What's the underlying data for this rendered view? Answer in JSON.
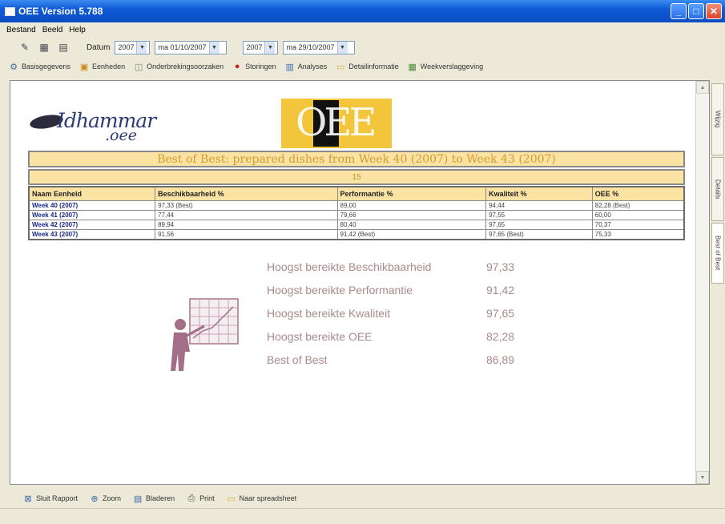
{
  "window": {
    "title": "OEE Version 5.788"
  },
  "menu": [
    "Bestand",
    "Beeld",
    "Help"
  ],
  "toolbar1": {
    "datum_label": "Datum",
    "combo1": {
      "year": "2007",
      "date": "ma 01/10/2007"
    },
    "combo2": {
      "year": "2007",
      "date": "ma 29/10/2007"
    }
  },
  "toolbar2": {
    "items": [
      {
        "icon": "settings-icon",
        "label": "Basisgegevens"
      },
      {
        "icon": "units-icon",
        "label": "Eenheden"
      },
      {
        "icon": "downtime-icon",
        "label": "Onderbrekingsoorzaken"
      },
      {
        "icon": "alert-icon",
        "label": "Storingen"
      },
      {
        "icon": "chart-icon",
        "label": "Analyses"
      },
      {
        "icon": "detail-icon",
        "label": "Detailinformatie"
      },
      {
        "icon": "report-icon",
        "label": "Weekverslaggeving"
      }
    ]
  },
  "sidetabs": [
    "Wijzig",
    "Details",
    "Best of Best"
  ],
  "report": {
    "logo": {
      "name": "Idhammar",
      "sub": ".oee"
    },
    "title": "Best of Best: prepared dishes from Week 40 (2007) to Week 43 (2007)",
    "subtitle": "15",
    "table": {
      "headers": [
        "Naam Eenheid",
        "Beschikbaarheid %",
        "Performantie %",
        "Kwaliteit %",
        "OEE %"
      ],
      "rows": [
        [
          "Week 40 (2007)",
          "97,33 (Best)",
          "89,00",
          "94,44",
          "82,28 (Best)"
        ],
        [
          "Week 41 (2007)",
          "77,44",
          "79,66",
          "97,55",
          "60,00"
        ],
        [
          "Week 42 (2007)",
          "89,94",
          "80,40",
          "97,65",
          "70,37"
        ],
        [
          "Week 43 (2007)",
          "91,56",
          "91,42 (Best)",
          "97,65 (Best)",
          "75,33"
        ]
      ]
    },
    "summary": [
      {
        "label": "Hoogst bereikte Beschikbaarheid",
        "value": "97,33"
      },
      {
        "label": "Hoogst bereikte Performantie",
        "value": "91,42"
      },
      {
        "label": "Hoogst bereikte Kwaliteit",
        "value": "97,65"
      },
      {
        "label": "Hoogst bereikte OEE",
        "value": "82,28"
      },
      {
        "label": "Best of Best",
        "value": "86,89"
      }
    ]
  },
  "bottombar": [
    {
      "icon": "close-report-icon",
      "label": "Sluit Rapport"
    },
    {
      "icon": "zoom-icon",
      "label": "Zoom"
    },
    {
      "icon": "browse-icon",
      "label": "Bladeren"
    },
    {
      "icon": "print-icon",
      "label": "Print"
    },
    {
      "icon": "export-icon",
      "label": "Naar spreadsheet"
    }
  ]
}
